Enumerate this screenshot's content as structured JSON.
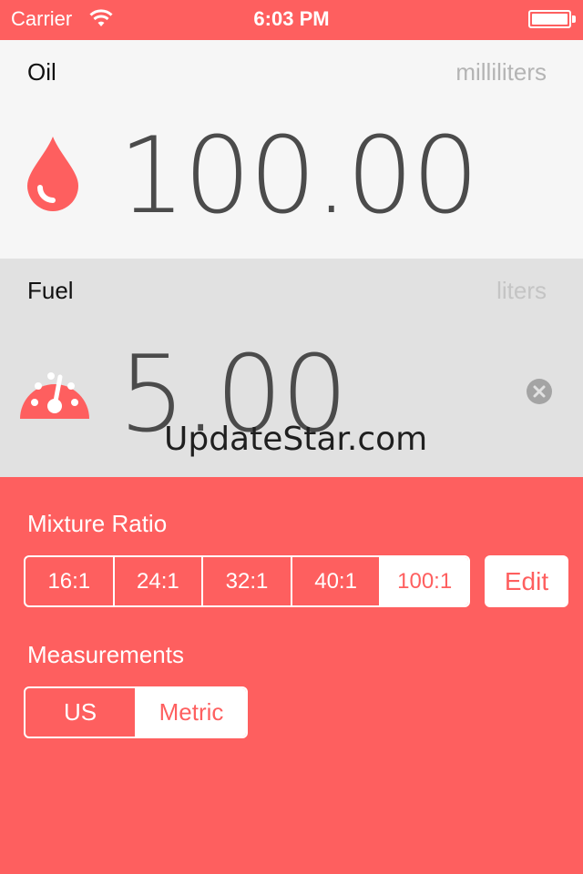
{
  "status_bar": {
    "carrier": "Carrier",
    "time": "6:03 PM"
  },
  "oil": {
    "label": "Oil",
    "unit": "milliliters",
    "value": "100.00",
    "icon": "drop-icon"
  },
  "fuel": {
    "label": "Fuel",
    "unit": "liters",
    "value": "5.00",
    "icon": "gauge-icon"
  },
  "watermark": "UpdateStar.com",
  "mixture": {
    "label": "Mixture Ratio",
    "options": [
      "16:1",
      "24:1",
      "32:1",
      "40:1",
      "100:1"
    ],
    "selected": "100:1",
    "edit_label": "Edit"
  },
  "measurements": {
    "label": "Measurements",
    "options": [
      "US",
      "Metric"
    ],
    "selected": "Metric"
  },
  "colors": {
    "accent": "#fe5f5f",
    "oil_panel_bg": "#f6f6f6",
    "fuel_panel_bg": "#e1e1e1",
    "value_text": "#4b4b4b"
  }
}
